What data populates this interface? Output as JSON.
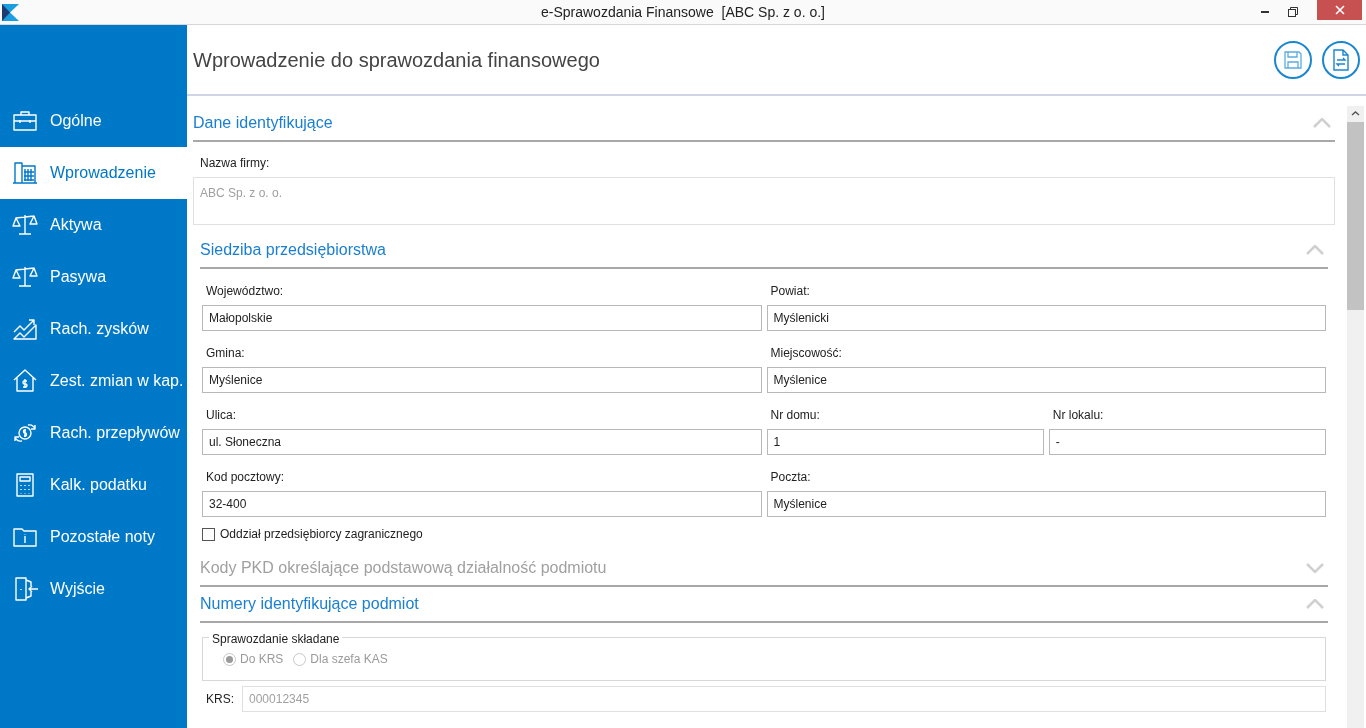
{
  "window": {
    "title": "e-Sprawozdania Finansowe  [ABC Sp. z o. o.]"
  },
  "sidebar": {
    "items": [
      {
        "label": "Ogólne",
        "kind": "briefcase",
        "selected": false
      },
      {
        "label": "Wprowadzenie",
        "kind": "building",
        "selected": true
      },
      {
        "label": "Aktywa",
        "kind": "scales",
        "selected": false
      },
      {
        "label": "Pasywa",
        "kind": "scales",
        "selected": false
      },
      {
        "label": "Rach. zysków",
        "kind": "chart",
        "selected": false
      },
      {
        "label": "Zest. zmian w kap.",
        "kind": "house",
        "selected": false
      },
      {
        "label": "Rach. przepływów",
        "kind": "coin",
        "selected": false
      },
      {
        "label": "Kalk. podatku",
        "kind": "calculator",
        "selected": false
      },
      {
        "label": "Pozostałe noty",
        "kind": "folder",
        "selected": false
      },
      {
        "label": "Wyjście",
        "kind": "door",
        "selected": false
      }
    ]
  },
  "header": {
    "title": "Wprowadzenie do sprawozdania finansowego"
  },
  "sections": [
    {
      "title": "Dane identyfikujące",
      "kind": "name",
      "expanded": true,
      "field": {
        "label": "Nazwa firmy:",
        "value": "ABC Sp. z o. o.",
        "disabled": true
      }
    },
    {
      "title": "Siedziba przedsiębiorstwa",
      "kind": "address",
      "expanded": true,
      "rows": [
        [
          {
            "label": "Województwo:",
            "value": "Małopolskie"
          },
          {
            "label": "Powiat:",
            "value": "Myślenicki"
          }
        ],
        [
          {
            "label": "Gmina:",
            "value": "Myślenice"
          },
          {
            "label": "Miejscowość:",
            "value": "Myślenice"
          }
        ],
        [
          {
            "label": "Ulica:",
            "value": "ul. Słoneczna"
          },
          {
            "label": "Nr domu:",
            "value": "1"
          },
          {
            "label": "Nr lokalu:",
            "value": "-"
          }
        ],
        [
          {
            "label": "Kod pocztowy:",
            "value": "32-400"
          },
          {
            "label": "Poczta:",
            "value": "Myślenice"
          }
        ]
      ],
      "checkbox": {
        "label": "Oddział przedsiębiorcy zagranicznego",
        "checked": false
      }
    },
    {
      "title": "Kody PKD określające podstawową działalność podmiotu",
      "expanded": false
    },
    {
      "title": "Numery identyfikujące podmiot",
      "kind": "numbers",
      "expanded": true,
      "group": {
        "legend": "Sprawozdanie składane",
        "disabled": true,
        "options": [
          {
            "label": "Do KRS",
            "selected": true
          },
          {
            "label": "Dla szefa KAS",
            "selected": false
          }
        ]
      },
      "field": {
        "label": "KRS:",
        "value": "000012345",
        "disabled": true
      }
    }
  ]
}
